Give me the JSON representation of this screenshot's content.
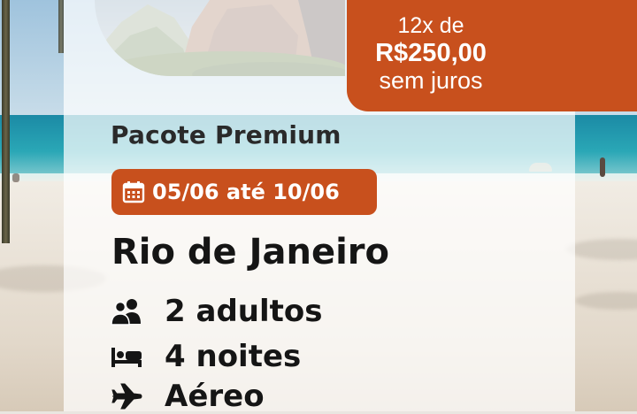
{
  "offer": {
    "installments": "12x de",
    "price": "R$250,00",
    "interest": "sem juros"
  },
  "package": {
    "title": "Pacote Premium",
    "dates": "05/06 até 10/06",
    "destination": "Rio de Janeiro"
  },
  "features": [
    {
      "icon": "users-icon",
      "label": "2 adultos"
    },
    {
      "icon": "bed-icon",
      "label": "4 noites"
    },
    {
      "icon": "airplane-icon",
      "label": "Aéreo"
    }
  ],
  "colors": {
    "accent": "#c8501d",
    "text": "#151515"
  }
}
